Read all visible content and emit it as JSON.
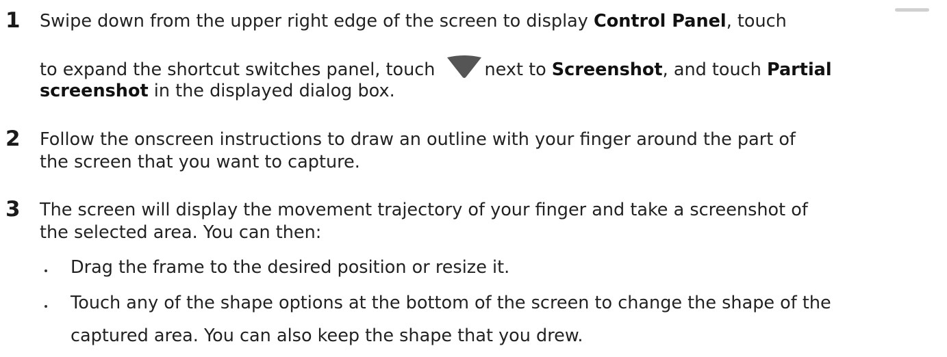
{
  "steps": [
    {
      "number": "1",
      "lines": [
        {
          "text_a": "Swipe down from the upper right edge of the screen to display ",
          "bold_a": "Control Panel",
          "text_b": ", touch"
        },
        {
          "text_a": "to expand the shortcut switches panel, touch",
          "text_b": "next to ",
          "bold_b": "Screenshot",
          "text_c": ", and touch ",
          "bold_c": "Partial"
        },
        {
          "bold_a": "screenshot",
          "text_a": " in the displayed dialog box."
        }
      ]
    },
    {
      "number": "2",
      "lines": [
        "Follow the onscreen instructions to draw an outline with your finger around the part of",
        "the screen that you want to capture."
      ]
    },
    {
      "number": "3",
      "lines": [
        "The screen will display the movement trajectory of your finger and take a screenshot of",
        "the selected area. You can then:"
      ],
      "bullets": [
        [
          "Drag the frame to the desired position or resize it."
        ],
        [
          "Touch any of the shape options at the bottom of the screen to change the shape of the",
          "captured area. You can also keep the shape that you drew."
        ]
      ]
    }
  ],
  "icons": {
    "panel_handle": "expand-bar-icon",
    "dropdown": "dropdown-triangle-icon",
    "dropdown_color": "#555555",
    "handle_color": "#d0d0d0"
  }
}
